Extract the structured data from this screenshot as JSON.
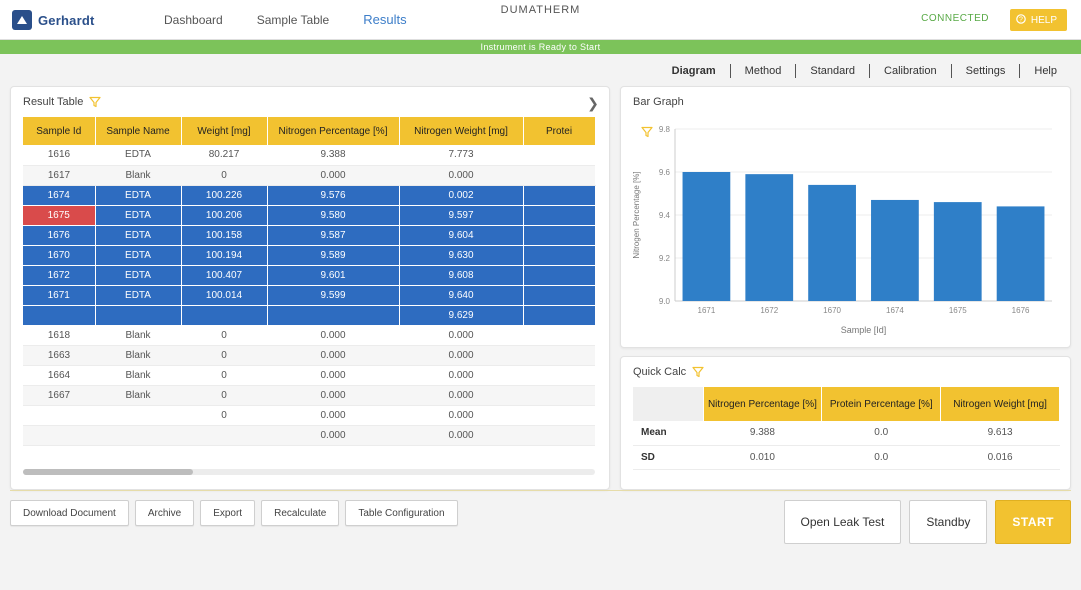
{
  "app": {
    "title": "DUMATHERM",
    "logo_text": "Gerhardt",
    "connection_status": "CONNECTED",
    "help_label": "HELP",
    "status_message": "Instrument is Ready to Start"
  },
  "top_nav": [
    {
      "label": "Dashboard",
      "active": false
    },
    {
      "label": "Sample Table",
      "active": false
    },
    {
      "label": "Results",
      "active": true
    }
  ],
  "sub_nav": [
    {
      "label": "Diagram",
      "active": true
    },
    {
      "label": "Method",
      "active": false
    },
    {
      "label": "Standard",
      "active": false
    },
    {
      "label": "Calibration",
      "active": false
    },
    {
      "label": "Settings",
      "active": false
    },
    {
      "label": "Help",
      "active": false
    }
  ],
  "result_table": {
    "title": "Result Table",
    "columns": [
      "Sample Id",
      "Sample Name",
      "Weight [mg]",
      "Nitrogen Percentage [%]",
      "Nitrogen Weight [mg]",
      "Protei"
    ],
    "rows": [
      {
        "style": "white",
        "cells": [
          "1616",
          "EDTA",
          "80.217",
          "9.388",
          "7.773",
          ""
        ]
      },
      {
        "style": "grey",
        "cells": [
          "1617",
          "Blank",
          "0",
          "0.000",
          "0.000",
          ""
        ]
      },
      {
        "style": "sel",
        "cells": [
          "1674",
          "EDTA",
          "100.226",
          "9.576",
          "0.002",
          ""
        ]
      },
      {
        "style": "sel",
        "bad": true,
        "cells": [
          "1675",
          "EDTA",
          "100.206",
          "9.580",
          "9.597",
          ""
        ]
      },
      {
        "style": "sel",
        "cells": [
          "1676",
          "EDTA",
          "100.158",
          "9.587",
          "9.604",
          ""
        ]
      },
      {
        "style": "sel",
        "cells": [
          "1670",
          "EDTA",
          "100.194",
          "9.589",
          "9.630",
          ""
        ]
      },
      {
        "style": "sel",
        "cells": [
          "1672",
          "EDTA",
          "100.407",
          "9.601",
          "9.608",
          ""
        ]
      },
      {
        "style": "sel",
        "cells": [
          "1671",
          "EDTA",
          "100.014",
          "9.599",
          "9.640",
          ""
        ]
      },
      {
        "style": "sel",
        "cells": [
          "",
          "",
          "",
          "",
          "9.629",
          ""
        ]
      },
      {
        "style": "white",
        "cells": [
          "1618",
          "Blank",
          "0",
          "0.000",
          "0.000",
          ""
        ]
      },
      {
        "style": "grey",
        "cells": [
          "1663",
          "Blank",
          "0",
          "0.000",
          "0.000",
          ""
        ]
      },
      {
        "style": "white",
        "cells": [
          "1664",
          "Blank",
          "0",
          "0.000",
          "0.000",
          ""
        ]
      },
      {
        "style": "grey",
        "cells": [
          "1667",
          "Blank",
          "0",
          "0.000",
          "0.000",
          ""
        ]
      },
      {
        "style": "white",
        "cells": [
          "",
          "",
          "0",
          "0.000",
          "0.000",
          ""
        ]
      },
      {
        "style": "grey",
        "cells": [
          "",
          "",
          "",
          "0.000",
          "0.000",
          ""
        ]
      }
    ]
  },
  "bar_graph": {
    "title": "Bar Graph"
  },
  "chart_data": {
    "type": "bar",
    "title": "Bar Graph",
    "categories": [
      "1671",
      "1672",
      "1670",
      "1674",
      "1675",
      "1676"
    ],
    "values": [
      9.6,
      9.59,
      9.54,
      9.47,
      9.46,
      9.44
    ],
    "ylim": [
      9.0,
      9.8
    ],
    "xlabel": "Sample [Id]",
    "ylabel": "Nitrogen Percentage [%]",
    "grid": true,
    "bar_color": "#2f7fc8"
  },
  "quick_calc": {
    "title": "Quick Calc",
    "columns": [
      "Nitrogen Percentage [%]",
      "Protein Percentage [%]",
      "Nitrogen Weight [mg]"
    ],
    "rows": [
      {
        "label": "Mean",
        "values": [
          "9.388",
          "0.0",
          "9.613"
        ]
      },
      {
        "label": "SD",
        "values": [
          "0.010",
          "0.0",
          "0.016"
        ]
      }
    ]
  },
  "actions": [
    "Download Document",
    "Archive",
    "Export",
    "Recalculate",
    "Table Configuration"
  ],
  "controls": {
    "leak_test": "Open Leak Test",
    "standby": "Standby",
    "start": "START"
  },
  "colors": {
    "accent": "#f2c230",
    "selected_row": "#2e6cc0",
    "status_bar": "#7cc35a",
    "alert": "#d94b4b"
  }
}
